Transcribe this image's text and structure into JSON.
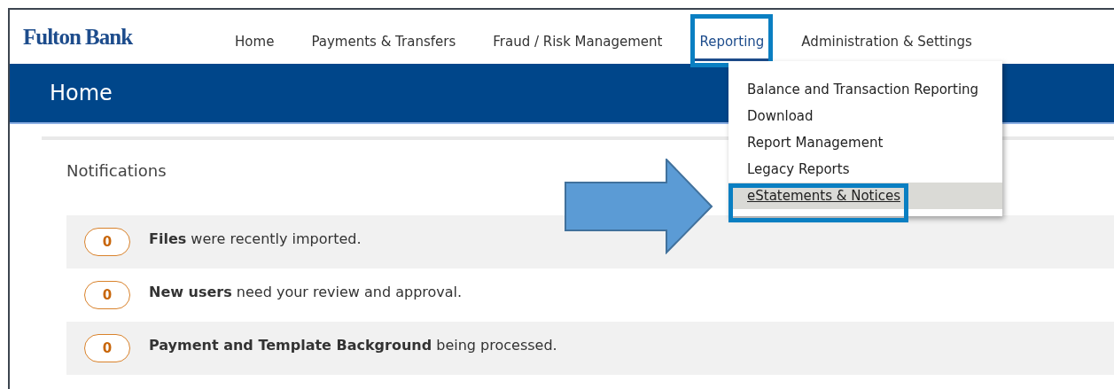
{
  "brand": "Fulton Bank",
  "nav": [
    {
      "label": "Home",
      "selected": false
    },
    {
      "label": "Payments & Transfers",
      "selected": false
    },
    {
      "label": "Fraud / Risk Management",
      "selected": false
    },
    {
      "label": "Reporting",
      "selected": true
    },
    {
      "label": "Administration & Settings",
      "selected": false
    }
  ],
  "page_title": "Home",
  "dropdown": {
    "items": [
      {
        "label": "Balance and Transaction Reporting",
        "selected": false
      },
      {
        "label": "Download",
        "selected": false
      },
      {
        "label": "Report Management",
        "selected": false
      },
      {
        "label": "Legacy Reports",
        "selected": false
      },
      {
        "label": "eStatements & Notices",
        "selected": true
      }
    ]
  },
  "notifications": {
    "title": "Notifications",
    "rows": [
      {
        "count": "0",
        "text": "**Files** were recently imported."
      },
      {
        "count": "0",
        "text": "**New users** need your review and approval."
      },
      {
        "count": "0",
        "text": "**Payment and Template Background** being processed."
      }
    ]
  }
}
